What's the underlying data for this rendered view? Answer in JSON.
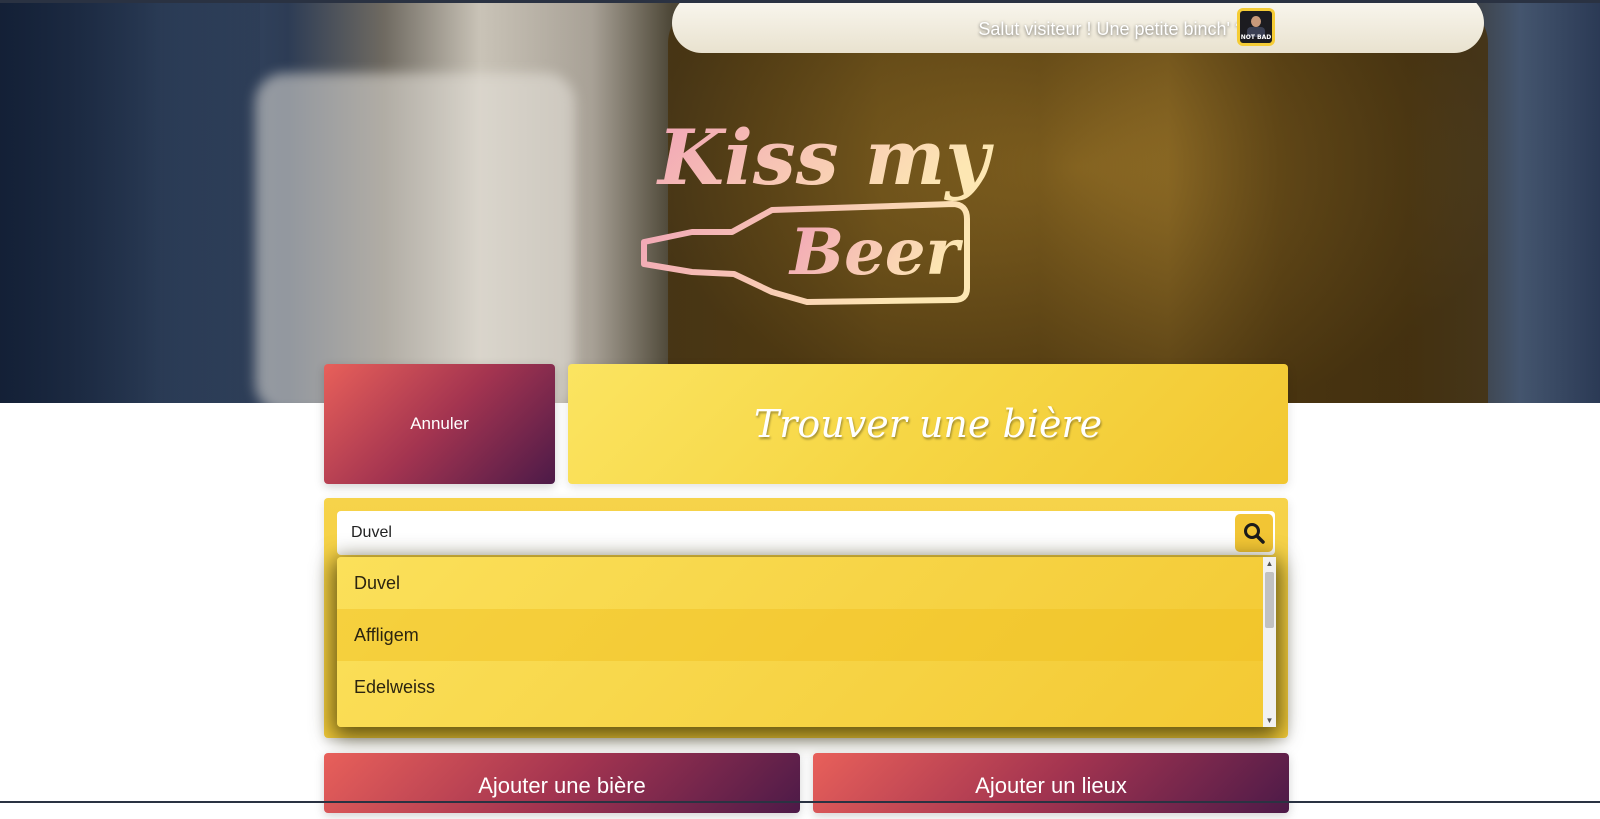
{
  "header": {
    "greeting": "Salut visiteur ! Une petite binch' ?",
    "avatar_caption": "NOT BAD"
  },
  "logo": {
    "line1": "Kiss my",
    "line2": "Beer"
  },
  "actions": {
    "cancel_label": "Annuler",
    "title": "Trouver une bière"
  },
  "search": {
    "value": "Duvel",
    "placeholder": "",
    "icon": "search-icon",
    "suggestions": [
      "Duvel",
      "Affligem",
      "Edelweiss"
    ]
  },
  "bottom": {
    "add_beer_label": "Ajouter une bière",
    "add_place_label": "Ajouter un lieux"
  },
  "colors": {
    "accent_yellow": "#f6d644",
    "gradient_start": "#e8605a",
    "gradient_end": "#4c1a48",
    "logo_pink": "#f1a3b6",
    "logo_cream": "#fde7b3"
  }
}
